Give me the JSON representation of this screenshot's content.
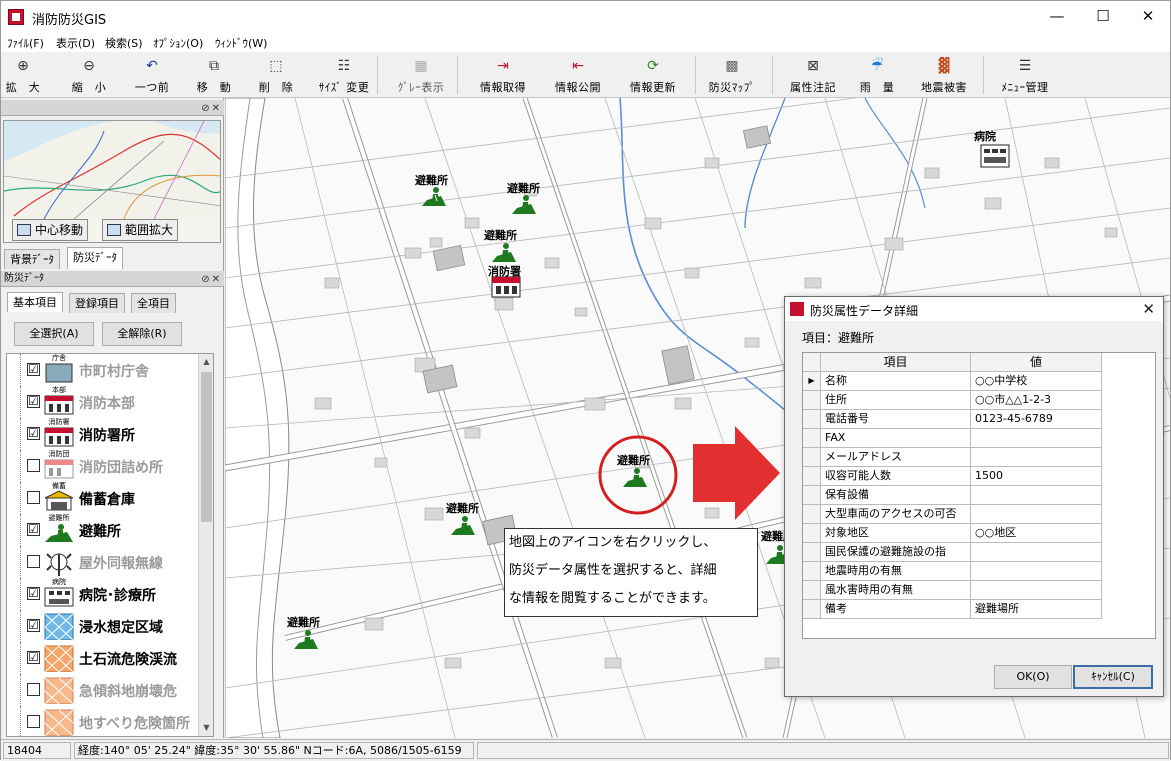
{
  "app": {
    "title": "消防防災GIS",
    "win_minimize": "—",
    "win_maximize": "☐",
    "win_close": "✕"
  },
  "menu": [
    "ﾌｧｲﾙ(F)",
    "表示(D)",
    "検索(S)",
    "ｵﾌﾟｼｮﾝ(O)",
    "ｳｨﾝﾄﾞｳ(W)"
  ],
  "toolbar": {
    "zoom_in": "拡　大",
    "zoom_out": "縮　小",
    "back": "一つ前",
    "move": "移　動",
    "delete": "削　除",
    "resize": "ｻｲｽﾞ 変更",
    "gray": "ｸﾞﾚｰ表示",
    "info_get": "情報取得",
    "info_publish": "情報公開",
    "info_update": "情報更新",
    "disaster_map": "防災ﾏｯﾌﾟ",
    "attr_note": "属性注記",
    "rainfall": "雨　量",
    "quake_damage": "地震被害",
    "menu_manage": "ﾒﾆｭｰ管理"
  },
  "minimap": {
    "center_move": "中心移動",
    "range_expand": "範囲拡大"
  },
  "data_tabs": [
    "背景ﾃﾞｰﾀ",
    "防災ﾃﾞｰﾀ"
  ],
  "panel_caption": "防災ﾃﾞｰﾀ",
  "sub_tabs": [
    "基本項目",
    "登録項目",
    "全項目"
  ],
  "select_all": "全選択(A)",
  "deselect_all": "全解除(R)",
  "layers": [
    {
      "tag": "庁舎",
      "label": "市町村庁舎",
      "checked": "☑",
      "state": "off"
    },
    {
      "tag": "本部",
      "label": "消防本部",
      "checked": "☑",
      "state": "off"
    },
    {
      "tag": "消防署",
      "label": "消防署所",
      "checked": "☑",
      "state": "on"
    },
    {
      "tag": "消防団",
      "label": "消防団詰め所",
      "checked": "",
      "state": "off"
    },
    {
      "tag": "備蓄",
      "label": "備蓄倉庫",
      "checked": "",
      "state": "on"
    },
    {
      "tag": "避難所",
      "label": "避難所",
      "checked": "☑",
      "state": "on"
    },
    {
      "tag": "",
      "label": "屋外同報無線",
      "checked": "",
      "state": "off"
    },
    {
      "tag": "病院",
      "label": "病院･診療所",
      "checked": "☑",
      "state": "on"
    },
    {
      "tag": "",
      "label": "浸水想定区域",
      "checked": "☑",
      "state": "on"
    },
    {
      "tag": "",
      "label": "土石流危険渓流",
      "checked": "☑",
      "state": "on"
    },
    {
      "tag": "",
      "label": "急傾斜地崩壊危",
      "checked": "",
      "state": "off"
    },
    {
      "tag": "",
      "label": "地すべり危険箇所",
      "checked": "",
      "state": "off"
    }
  ],
  "map": {
    "shelter_label": "避難所",
    "fire_station_label": "消防署",
    "hospital_label": "病院"
  },
  "callout": {
    "line1": "地図上のアイコンを右クリックし、",
    "line2": "防災データ属性を選択すると、詳細",
    "line3": "な情報を閲覧することができます。"
  },
  "dialog": {
    "title": "防災属性データ詳細",
    "item": "項目：避難所",
    "col_item": "項目",
    "col_value": "値",
    "rows": [
      {
        "k": "名称",
        "v": "○○中学校"
      },
      {
        "k": "住所",
        "v": "○○市△△1-2-3"
      },
      {
        "k": "電話番号",
        "v": "0123-45-6789"
      },
      {
        "k": "FAX",
        "v": ""
      },
      {
        "k": "メールアドレス",
        "v": ""
      },
      {
        "k": "収容可能人数",
        "v": "1500"
      },
      {
        "k": "保有設備",
        "v": ""
      },
      {
        "k": "大型車両のアクセスの可否",
        "v": ""
      },
      {
        "k": "対象地区",
        "v": "○○地区"
      },
      {
        "k": "国民保護の避難施設の指",
        "v": ""
      },
      {
        "k": "地震時用の有無",
        "v": ""
      },
      {
        "k": "風水害時用の有無",
        "v": ""
      },
      {
        "k": "備考",
        "v": "避難場所"
      }
    ],
    "ok": "OK(O)",
    "cancel": "ｷｬﾝｾﾙ(C)",
    "close": "✕"
  },
  "status": {
    "scale": "18404",
    "coords": "経度:140° 05' 25.24\"  緯度:35° 30' 55.86\"  Nコード:6A, 5086/1505-6159"
  }
}
